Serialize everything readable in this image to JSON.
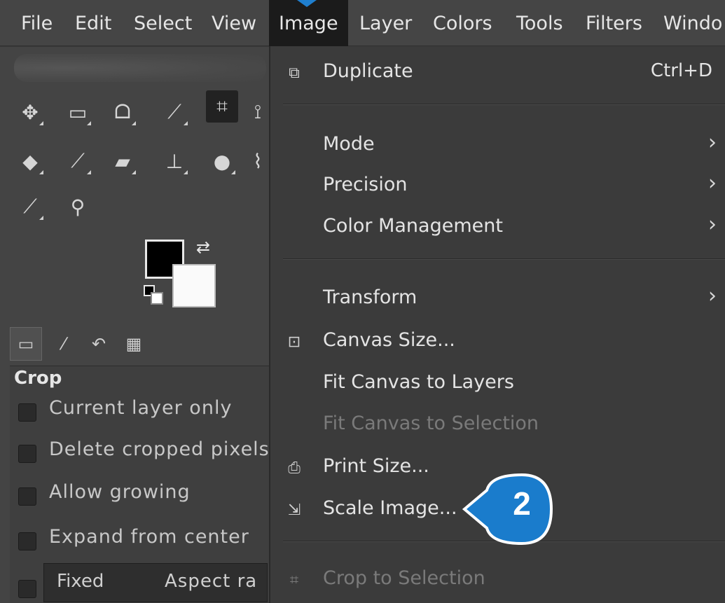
{
  "menubar": {
    "items": [
      "File",
      "Edit",
      "Select",
      "View",
      "Image",
      "Layer",
      "Colors",
      "Tools",
      "Filters",
      "Windo"
    ],
    "active_index": 4
  },
  "tool_options": {
    "title": "Crop",
    "options": [
      {
        "label": "Current layer only",
        "checked": false
      },
      {
        "label": "Delete cropped pixels",
        "checked": false
      },
      {
        "label": "Allow growing",
        "checked": false
      },
      {
        "label": "Expand from center",
        "checked": false
      }
    ],
    "fixed": {
      "label": "Fixed",
      "value": "Aspect ra"
    }
  },
  "image_menu": {
    "duplicate": {
      "label": "Duplicate",
      "shortcut": "Ctrl+D"
    },
    "mode": {
      "label": "Mode"
    },
    "precision": {
      "label": "Precision"
    },
    "color_management": {
      "label": "Color Management"
    },
    "transform": {
      "label": "Transform"
    },
    "canvas_size": {
      "label": "Canvas Size..."
    },
    "fit_canvas_layers": {
      "label": "Fit Canvas to Layers"
    },
    "fit_canvas_selection": {
      "label": "Fit Canvas to Selection"
    },
    "print_size": {
      "label": "Print Size..."
    },
    "scale_image": {
      "label": "Scale Image..."
    },
    "crop_selection": {
      "label": "Crop to Selection"
    }
  },
  "callout": {
    "number": "2",
    "color": "#1a7ccc"
  },
  "colors": {
    "fg": "#000000",
    "bg": "#ffffff",
    "accent": "#1a7ccc"
  }
}
